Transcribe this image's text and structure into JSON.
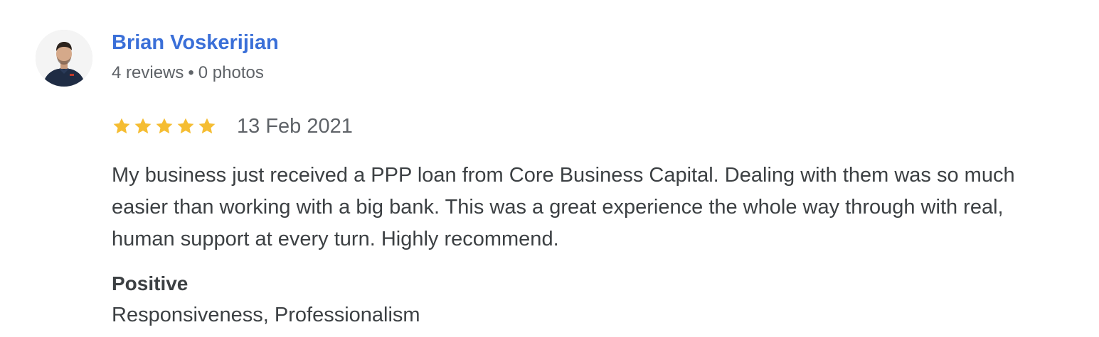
{
  "reviewer": {
    "name": "Brian Voskerijian",
    "reviews_count": "4 reviews",
    "separator": "•",
    "photos_count": "0 photos"
  },
  "review": {
    "rating": 5,
    "rating_max": 5,
    "star_color": "#f5bd32",
    "date": "13 Feb 2021",
    "text": "My business just received a PPP loan from Core Business Capital. Dealing with them was so much easier than working with a big bank. This was a great experience the whole way through with real, human support at every turn. Highly recommend."
  },
  "attributes": {
    "heading": "Positive",
    "values": "Responsiveness, Professionalism"
  },
  "colors": {
    "name_link": "#3a6fd8",
    "meta_text": "#5f6368",
    "body_text": "#3c4043"
  }
}
